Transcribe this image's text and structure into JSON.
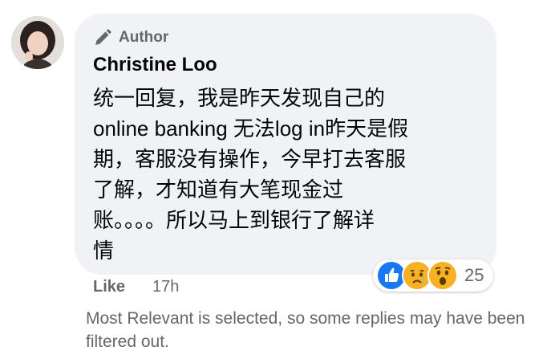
{
  "comment": {
    "author_badge": "Author",
    "name": "Christine Loo",
    "text": "统一回复，我是昨天发现自己的\nonline banking 无法log in昨天是假\n期，客服没有操作，今早打去客服\n了解，才知道有大笔现金过\n账。。。。所以马上到银行了解详\n情",
    "avatar": "profile-photo"
  },
  "reactions": {
    "icons": [
      "like-icon",
      "sad-icon",
      "wow-icon"
    ],
    "count": "25"
  },
  "actions": {
    "like_label": "Like",
    "timestamp": "17h"
  },
  "filter_note": "Most Relevant is selected, so some replies may have been filtered out.",
  "colors": {
    "bubble": "#f0f2f5",
    "secondary_text": "#65676b",
    "primary_text": "#050505",
    "like_blue": "#1877f2",
    "emoji_yellow": "#f7b125"
  }
}
